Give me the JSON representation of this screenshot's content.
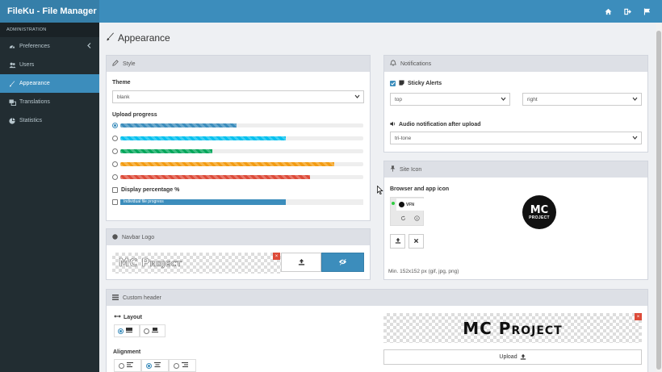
{
  "app": {
    "title": "FileKu - File Manager"
  },
  "topbar": {
    "icons": [
      "home-icon",
      "sign-out-icon",
      "flag-icon"
    ]
  },
  "sidebar": {
    "header": "ADMINISTRATION",
    "items": [
      {
        "label": "Preferences",
        "icon": "tachometer-icon",
        "active": false
      },
      {
        "label": "Users",
        "icon": "users-icon",
        "active": false
      },
      {
        "label": "Appearance",
        "icon": "paint-brush-icon",
        "active": true
      },
      {
        "label": "Translations",
        "icon": "language-icon",
        "active": false
      },
      {
        "label": "Statistics",
        "icon": "pie-chart-icon",
        "active": false
      }
    ]
  },
  "page": {
    "title": "Appearance"
  },
  "style_panel": {
    "title": "Style",
    "theme_label": "Theme",
    "theme_value": "blank",
    "upload_progress_label": "Upload progress",
    "progress_bars": [
      {
        "color": "#3c8dbc",
        "value": 0.48,
        "selected": true
      },
      {
        "color": "#00c0ef",
        "value": 0.68,
        "selected": false
      },
      {
        "color": "#00a65a",
        "value": 0.38,
        "selected": false
      },
      {
        "color": "#f39c12",
        "value": 0.88,
        "selected": false
      },
      {
        "color": "#dd4b39",
        "value": 0.78,
        "selected": false
      }
    ],
    "display_percentage_label": "Display percentage %",
    "individual_label": "Individual file progress",
    "individual_value": 0.68
  },
  "navbar_logo": {
    "title": "Navbar Logo",
    "logo_text": "MC Project",
    "remove": "×"
  },
  "notifications": {
    "title": "Notifications",
    "sticky_alerts_label": "Sticky Alerts",
    "position_v": "top",
    "position_h": "right",
    "audio_label": "Audio notification after upload",
    "audio_value": "tri-tone"
  },
  "site_icon": {
    "title": "Site Icon",
    "label": "Browser and app icon",
    "tab_text": "VFN",
    "icon_text_top": "MC",
    "icon_text_bottom": "PROJECT",
    "hint": "Min. 152x152 px (gif, jpg, png)"
  },
  "custom_header": {
    "title": "Custom header",
    "layout_label": "Layout",
    "alignment_label": "Alignment",
    "logo_text": "MC Project",
    "upload_label": "Upload",
    "remove": "×"
  }
}
